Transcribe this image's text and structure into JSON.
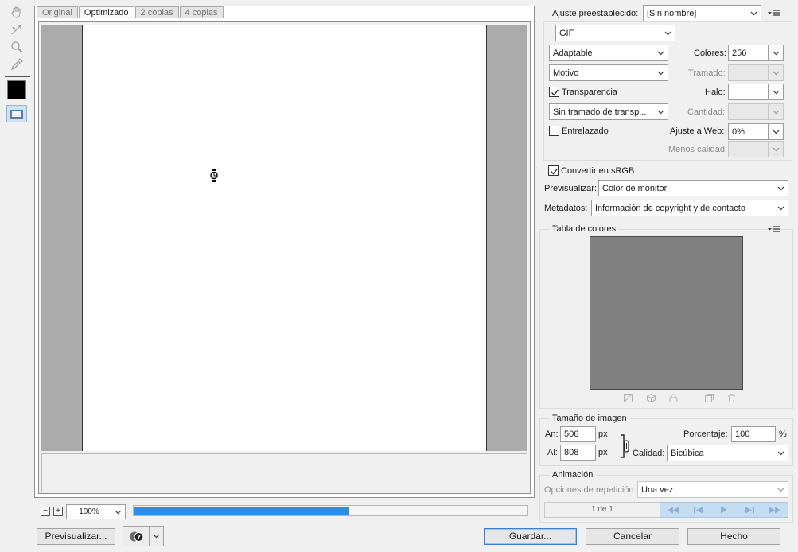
{
  "tabs": [
    "Original",
    "Optimizado",
    "2 copias",
    "4 copias"
  ],
  "zoom": {
    "value": "100%",
    "minus": "−",
    "plus": "+"
  },
  "progress": 0.55,
  "buttons": {
    "preview": "Previsualizar...",
    "save": "Guardar...",
    "cancel": "Cancelar",
    "done": "Hecho"
  },
  "preset": {
    "label": "Ajuste preestablecido:",
    "value": "[Sin nombre]"
  },
  "format": "GIF",
  "reduction": "Adaptable",
  "colors": {
    "label": "Colores:",
    "value": "256"
  },
  "dither_algo": "Motivo",
  "dither": {
    "label": "Tramado:",
    "value": ""
  },
  "transparency": {
    "label": "Transparencia",
    "checked": true
  },
  "matte": {
    "label": "Halo:",
    "value": ""
  },
  "trans_dither": "Sin tramado de transp...",
  "amount": {
    "label": "Cantidad:",
    "value": ""
  },
  "interlaced": {
    "label": "Entrelazado",
    "checked": false
  },
  "web_snap": {
    "label": "Ajuste a Web:",
    "value": "0%"
  },
  "lossy": {
    "label": "Menos calidad:",
    "value": ""
  },
  "convert_srgb": {
    "label": "Convertir en sRGB",
    "checked": true
  },
  "preview_mode": {
    "label": "Previsualizar:",
    "value": "Color de monitor"
  },
  "metadata": {
    "label": "Metadatos:",
    "value": "Información de copyright y de contacto"
  },
  "color_table": {
    "title": "Tabla de colores",
    "swatch_color": "#808080"
  },
  "image_size": {
    "title": "Tamaño de imagen",
    "width_label": "An:",
    "width": "506",
    "width_unit": "px",
    "height_label": "Al:",
    "height": "808",
    "height_unit": "px",
    "percent_label": "Porcentaje:",
    "percent": "100",
    "percent_unit": "%",
    "quality_label": "Calidad:",
    "quality": "Bicúbica"
  },
  "animation": {
    "title": "Animación",
    "loop_label": "Opciones de repetición:",
    "loop_value": "Una vez",
    "frame": "1 de 1"
  },
  "colors_theme": {
    "accent": "#2f8de4",
    "canvas_bg": "#ababab"
  }
}
